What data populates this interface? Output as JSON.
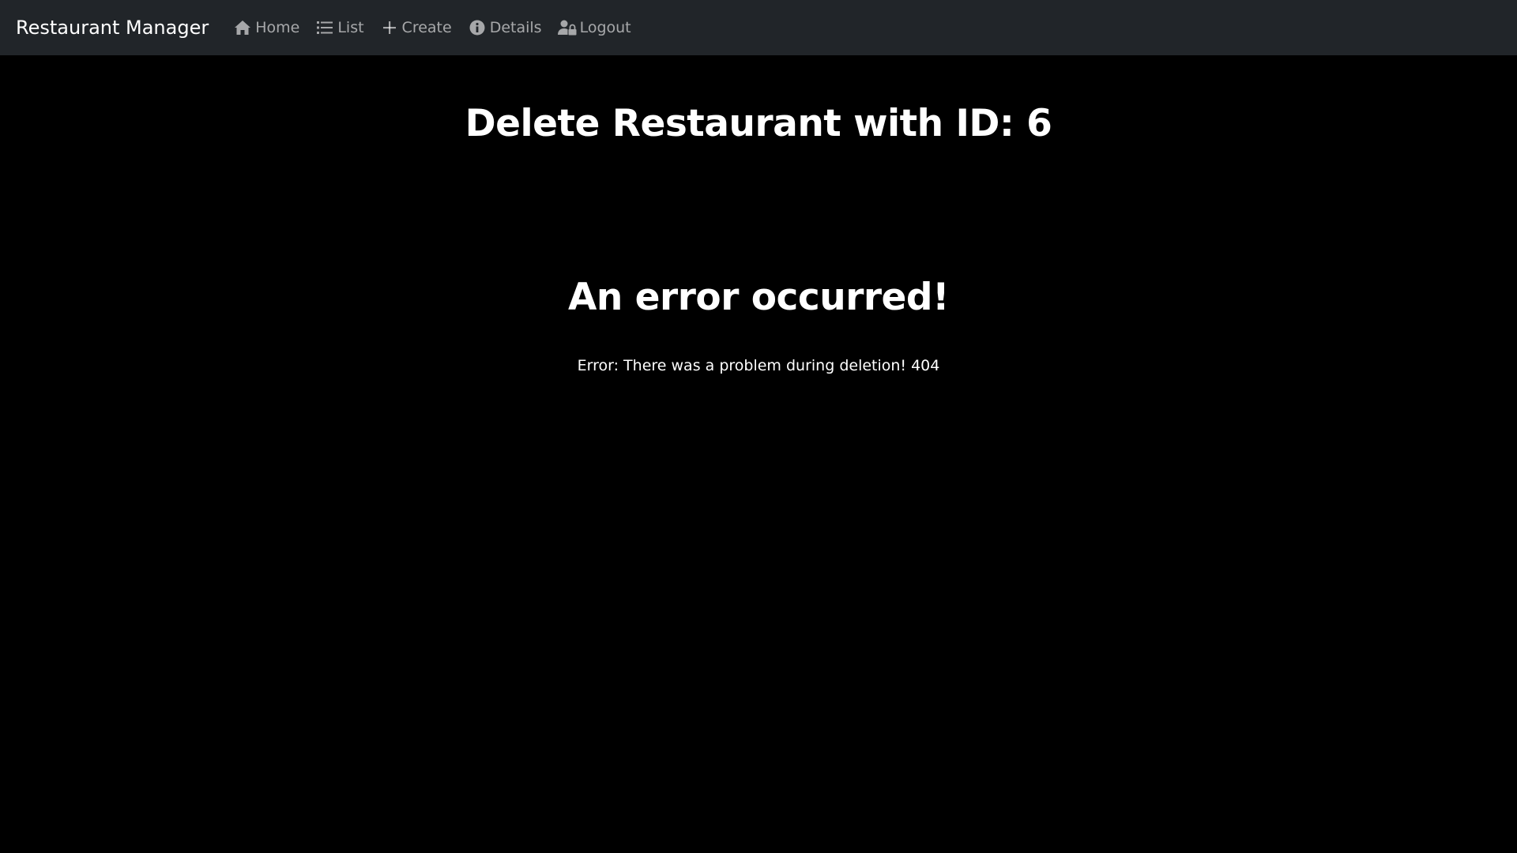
{
  "navbar": {
    "brand": "Restaurant Manager",
    "items": [
      {
        "label": "Home",
        "icon": "home-icon"
      },
      {
        "label": "List",
        "icon": "list-icon"
      },
      {
        "label": "Create",
        "icon": "plus-icon"
      },
      {
        "label": "Details",
        "icon": "info-circle-icon"
      },
      {
        "label": "Logout",
        "icon": "user-lock-icon"
      }
    ]
  },
  "main": {
    "title": "Delete Restaurant with ID: 6",
    "error_heading": "An error occurred!",
    "error_message": "Error: There was a problem during deletion! 404"
  },
  "colors": {
    "navbar_bg": "#212529",
    "page_bg": "#000000",
    "nav_text": "rgba(255,255,255,0.6)",
    "text": "#ffffff"
  }
}
